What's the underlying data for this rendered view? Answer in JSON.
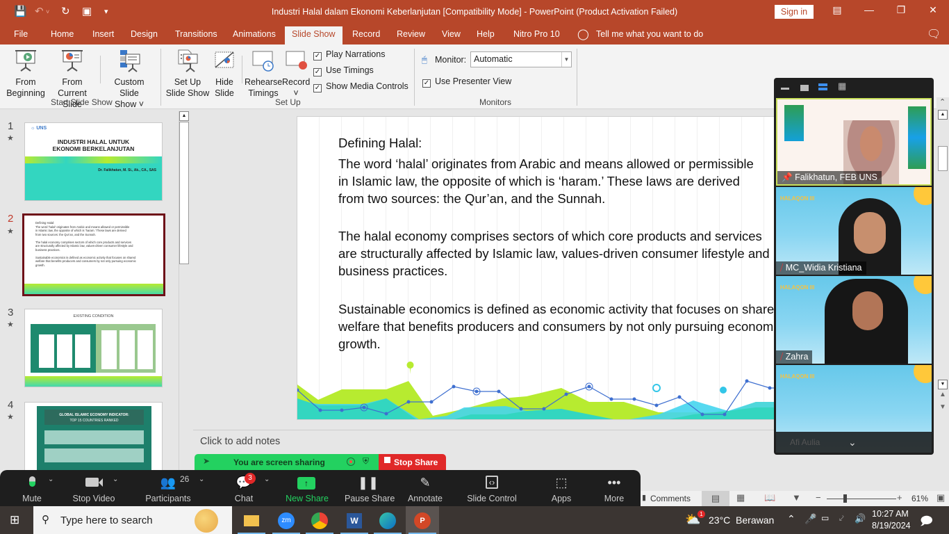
{
  "titlebar": {
    "title": "Industri Halal dalam Ekonomi Keberlanjutan [Compatibility Mode]  -  PowerPoint (Product Activation Failed)",
    "signin": "Sign in",
    "qa_icons": [
      "save-icon",
      "undo-icon",
      "redo-icon",
      "present-icon",
      "customize-icon"
    ]
  },
  "tabs": [
    {
      "label": "File"
    },
    {
      "label": "Home"
    },
    {
      "label": "Insert"
    },
    {
      "label": "Design"
    },
    {
      "label": "Transitions"
    },
    {
      "label": "Animations"
    },
    {
      "label": "Slide Show",
      "active": true
    },
    {
      "label": "Record"
    },
    {
      "label": "Review"
    },
    {
      "label": "View"
    },
    {
      "label": "Help"
    },
    {
      "label": "Nitro Pro 10"
    }
  ],
  "tellme": "Tell me what you want to do",
  "ribbon": {
    "start": {
      "from_beginning": [
        "From",
        "Beginning"
      ],
      "from_current": [
        "From",
        "Current Slide"
      ],
      "custom": [
        "Custom Slide",
        "Show ˅"
      ],
      "group": "Start Slide Show"
    },
    "setup": {
      "setup_show": [
        "Set Up",
        "Slide Show"
      ],
      "hide_slide": [
        "Hide",
        "Slide"
      ],
      "rehearse": [
        "Rehearse",
        "Timings"
      ],
      "record": [
        "Record",
        "˅"
      ],
      "play_narrations": "Play Narrations",
      "use_timings": "Use Timings",
      "show_media": "Show Media Controls",
      "group": "Set Up"
    },
    "monitors": {
      "monitor_label": "Monitor:",
      "monitor_value": "Automatic",
      "presenter_view": "Use Presenter View",
      "group": "Monitors"
    }
  },
  "thumbnails": [
    {
      "num": "1",
      "title": [
        "INDUSTRI HALAL UNTUK",
        "EKONOMI BERKELANJUTAN"
      ],
      "author": "Dr. Falikhatun, M. Si., Ak., CA., SAS"
    },
    {
      "num": "2",
      "selected": true
    },
    {
      "num": "3",
      "title": [
        "EXISTING CONDITION"
      ]
    },
    {
      "num": "4",
      "title": [
        "GLOBAL ISLAMIC ECONOMY INDICATOR:",
        "TOP 15 COUNTRIES RANKED"
      ]
    }
  ],
  "slide": {
    "heading": "Defining Halal:",
    "p1": [
      "The word ‘halal’ originates from Arabic and means allowed or permissible",
      "in Islamic law, the opposite of which is ‘haram.’ These laws are derived",
      "from two sources: the Qur’an, and the Sunnah."
    ],
    "p2": [
      "The halal economy comprises sectors of which core products and services",
      "are structurally affected by Islamic law, values-driven consumer lifestyle and",
      "business practices."
    ],
    "p3": [
      "Sustainable economics is defined as economic activity that focuses on shared",
      "welfare that benefits producers and consumers by not only pursuing economic",
      "growth."
    ]
  },
  "notes_placeholder": "Click to add notes",
  "zoom": {
    "participants": [
      {
        "name": "Falikhatun, FEB UNS",
        "pinned": true
      },
      {
        "name": "MC_Widia Kristiana",
        "muted": true
      },
      {
        "name": "Zahra",
        "muted": true
      },
      {
        "name": "Afi Aulia",
        "muted": true
      }
    ],
    "sharing_text": "You are screen sharing",
    "stop_share": "Stop Share",
    "toolbar": {
      "mute": "Mute",
      "stop_video": "Stop Video",
      "participants": "Participants",
      "participant_count": "26",
      "chat": "Chat",
      "chat_badge": "3",
      "new_share": "New Share",
      "pause_share": "Pause Share",
      "annotate": "Annotate",
      "slide_control": "Slide Control",
      "apps": "Apps",
      "more": "More"
    }
  },
  "statusbar": {
    "comments": "Comments",
    "zoom_level": "61%"
  },
  "taskbar": {
    "search_placeholder": "Type here to search",
    "weather": "23°C  Berawan",
    "weather_badge": "1",
    "time": "10:27 AM",
    "date": "8/19/2024"
  },
  "colors": {
    "accent": "#b7472a",
    "selected_slide": "#6e1018",
    "share_green": "#23d160",
    "stop_red": "#e02828"
  }
}
